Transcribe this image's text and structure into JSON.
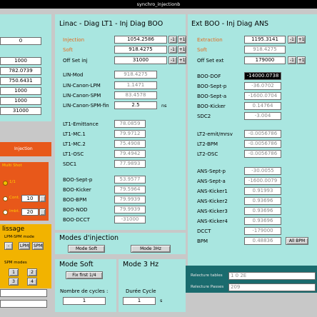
{
  "window": {
    "title": "synchro_injectionb"
  },
  "left_panel": {
    "values": [
      "0",
      "1000",
      "782.0739",
      "750.6431",
      "1000",
      "1000",
      "31000"
    ],
    "injection_label": "Injection",
    "multi_shot_label": "Multi Shot",
    "radio_options": [
      {
        "label": "1/1"
      },
      {
        "label": "Cont.",
        "value": "10"
      },
      {
        "label": "Imbt.",
        "value": "20"
      }
    ],
    "lissage": {
      "title": "lissage",
      "lpm_spm_mode": "LPM-SPM mode",
      "buttons": [
        "-",
        "LPM",
        "SPM"
      ],
      "spm_modes_label": "SPM modes",
      "spm_buttons": [
        "1",
        "2",
        "3",
        "4"
      ]
    }
  },
  "linac": {
    "title": "Linac - Diag LT1 - Inj Diag BOO",
    "injection": {
      "label": "Injection",
      "value": "1054.2586"
    },
    "soft": {
      "label": "Soft",
      "value": "918.4275"
    },
    "offset_inj": {
      "label": "Off Set inj",
      "value": "31000"
    },
    "buttons": [
      "-1",
      "+1"
    ],
    "rows": [
      {
        "label": "LIN-Mod",
        "value": "918.4275"
      },
      {
        "label": "LIN-Canon-LPM",
        "value": "1.1471"
      },
      {
        "label": "LIN-Canon-SPM",
        "value": "83.4578"
      },
      {
        "label": "LIN-Canon-SPM-fin",
        "value": "2.5",
        "unit": "ns"
      },
      {
        "label": "LT1-Emittance",
        "value": "78.0859"
      },
      {
        "label": "LT1-MC.1",
        "value": "79.9712"
      },
      {
        "label": "LT1-MC.2",
        "value": "75.4908"
      },
      {
        "label": "LT1-OSC",
        "value": "79.4942"
      },
      {
        "label": "SDC1",
        "value": "77.9893"
      },
      {
        "label": "BOO-Sept-p",
        "value": "53.9577"
      },
      {
        "label": "BOO-Kicker",
        "value": "79.5964"
      },
      {
        "label": "BOO-BPM",
        "value": "79.9939"
      },
      {
        "label": "BOO-NOD",
        "value": "79.9939"
      },
      {
        "label": "BOO-DCCT",
        "value": "-31000"
      }
    ]
  },
  "ext": {
    "title": "Ext BOO - Inj Diag ANS",
    "extraction": {
      "label": "Extraction",
      "value": "1195.3141"
    },
    "soft": {
      "label": "Soft",
      "value": "918.4275"
    },
    "offset_ext": {
      "label": "Off Set ext",
      "value": "179000"
    },
    "buttons": [
      "-1",
      "+1"
    ],
    "rows": [
      {
        "label": "BOO-DOF",
        "value": "-14000.0738"
      },
      {
        "label": "BOO-Sept-p",
        "value": "-36.0702"
      },
      {
        "label": "BOO-Sept-a",
        "value": "-1600.0704"
      },
      {
        "label": "BOO-Kicker",
        "value": "0.14764"
      },
      {
        "label": "SDC2",
        "value": "-3.004"
      },
      {
        "label": "LT2-emit/mrsv",
        "value": "-0.0056786"
      },
      {
        "label": "LT2-BPM",
        "value": "-0.0056786"
      },
      {
        "label": "LT2-OSC",
        "value": "-0.0056786"
      },
      {
        "label": "ANS-Sept-p",
        "value": "-30.0055"
      },
      {
        "label": "ANS-Sept-a",
        "value": "-1600.0079"
      },
      {
        "label": "ANS-Kicker1",
        "value": "0.91993"
      },
      {
        "label": "ANS-Kicker2",
        "value": "0.93696"
      },
      {
        "label": "ANS-Kicker3",
        "value": "0.93696"
      },
      {
        "label": "ANS-Kicker4",
        "value": "0.93696"
      },
      {
        "label": "DCCT",
        "value": "-179000"
      },
      {
        "label": "BPM",
        "value": "0.48836"
      }
    ],
    "all_bpm": "All BPM"
  },
  "modes_injection": {
    "title": "Modes d'injection",
    "mode_soft_btn": "Mode Soft",
    "mode_3hz_btn": "Mode 3Hz"
  },
  "mode_soft": {
    "title": "Mode Soft",
    "fix_first": "Fix first 1/4",
    "cycles_label": "Nombre de cycles :",
    "cycles_value": "1"
  },
  "mode_3hz": {
    "title": "Mode 3 Hz",
    "duree_label": "Durée Cycle",
    "duree_value": "1",
    "duree_unit": "s"
  },
  "tables": {
    "recture_tables_label": "Relecture tables",
    "recture_tables_value": "1 0 2E",
    "recture_passes_label": "Relecture Passes",
    "recture_passes_value": "209"
  }
}
